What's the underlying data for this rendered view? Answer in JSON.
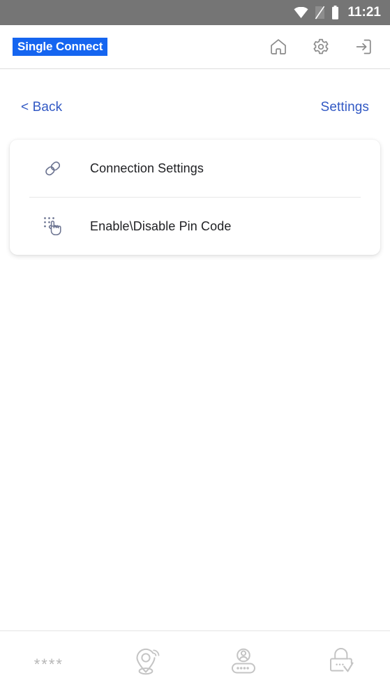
{
  "status_bar": {
    "time": "11:21",
    "icons": [
      "wifi-icon",
      "no-sim-icon",
      "battery-icon"
    ],
    "background_color": "#757575"
  },
  "header": {
    "title": "Single Connect",
    "title_background_color": "#1565f0",
    "title_text_color": "#ffffff",
    "icons": [
      {
        "name": "home-icon",
        "label": "Home"
      },
      {
        "name": "gear-icon",
        "label": "Settings"
      },
      {
        "name": "logout-icon",
        "label": "Logout"
      }
    ]
  },
  "nav": {
    "back_label": "< Back",
    "title_label": "Settings",
    "link_color": "#3259c4"
  },
  "menu": {
    "items": [
      {
        "icon": "link-icon",
        "label": "Connection Settings"
      },
      {
        "icon": "pin-code-icon",
        "label": "Enable\\Disable Pin Code"
      }
    ]
  },
  "bottom_nav": {
    "items": [
      {
        "name": "asterisks-icon",
        "label": "****"
      },
      {
        "name": "location-wifi-icon",
        "label": ""
      },
      {
        "name": "user-password-icon",
        "label": ""
      },
      {
        "name": "lock-check-icon",
        "label": ""
      }
    ],
    "icon_color": "#c4c4c4"
  }
}
